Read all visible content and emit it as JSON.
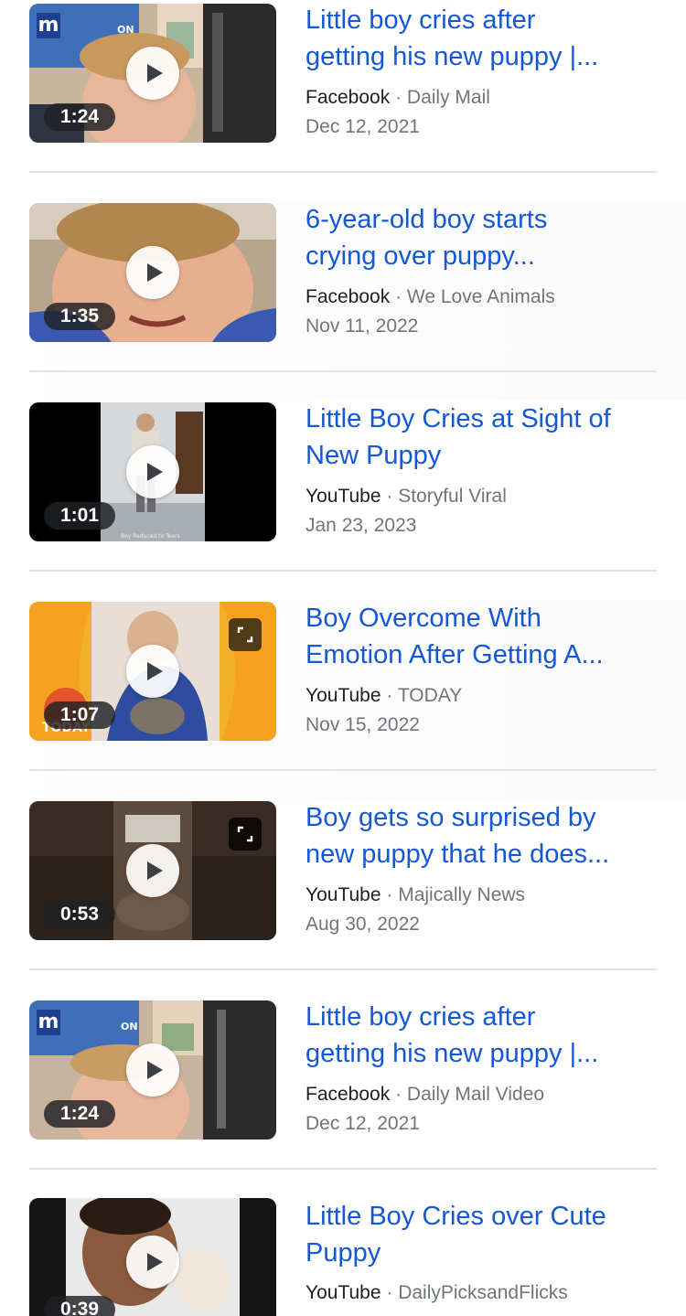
{
  "colors": {
    "title_link": "#1558d6",
    "source": "#202124",
    "secondary": "#70757a",
    "divider": "#e3e3e3"
  },
  "results": [
    {
      "title": "Little boy cries after\ngetting his new puppy |...",
      "source": "Facebook",
      "channel": "Daily Mail",
      "date": "Dec 12, 2021",
      "duration": "1:24",
      "thumb_caption": "",
      "thumb_logo": "m",
      "thumb_badge": "ON"
    },
    {
      "title": "6-year-old boy starts\ncrying over puppy...",
      "source": "Facebook",
      "channel": "We Love Animals",
      "date": "Nov 11, 2022",
      "duration": "1:35"
    },
    {
      "title": "Little Boy Cries at Sight of\nNew Puppy",
      "source": "YouTube",
      "channel": "Storyful Viral",
      "date": "Jan 23, 2023",
      "duration": "1:01",
      "thumb_caption": "Boy Reduced to Tears"
    },
    {
      "title": "Boy Overcome With\nEmotion After Getting A...",
      "source": "YouTube",
      "channel": "TODAY",
      "date": "Nov 15, 2022",
      "duration": "1:07",
      "thumb_logo": "TODAY"
    },
    {
      "title": "Boy gets so surprised by\nnew puppy that he does...",
      "source": "YouTube",
      "channel": "Majically News",
      "date": "Aug 30, 2022",
      "duration": "0:53"
    },
    {
      "title": "Little boy cries after\ngetting his new puppy |...",
      "source": "Facebook",
      "channel": "Daily Mail Video",
      "date": "Dec 12, 2021",
      "duration": "1:24",
      "thumb_logo": "m",
      "thumb_badge": "ON"
    },
    {
      "title": "Little Boy Cries over Cute\nPuppy",
      "source": "YouTube",
      "channel": "DailyPicksandFlicks",
      "date": "",
      "duration": "0:39"
    }
  ]
}
